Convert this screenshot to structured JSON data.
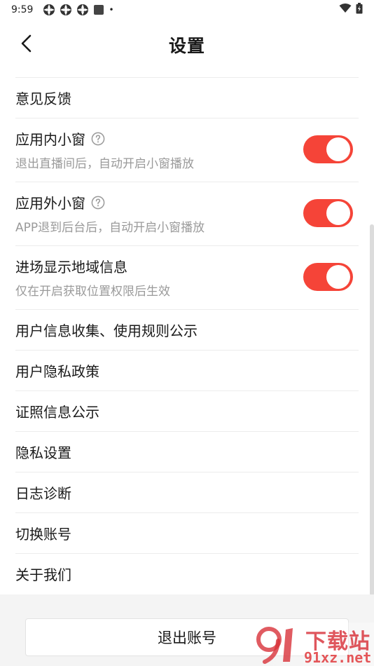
{
  "status_bar": {
    "time": "9:59",
    "notification_icons": [
      "app-icon",
      "app-icon",
      "app-icon",
      "app-icon"
    ],
    "dot": "•"
  },
  "nav": {
    "title": "设置",
    "back_icon": "chevron-left-icon"
  },
  "rows": {
    "feedback": {
      "label": "意见反馈"
    },
    "in_app_window": {
      "label": "应用内小窗",
      "desc": "退出直播间后，自动开启小窗播放",
      "enabled": true
    },
    "out_app_window": {
      "label": "应用外小窗",
      "desc": "APP退到后台后，自动开启小窗播放",
      "enabled": true
    },
    "region_info": {
      "label": "进场显示地域信息",
      "desc": "仅在开启获取位置权限后生效",
      "enabled": true
    },
    "user_info_rules": {
      "label": "用户信息收集、使用规则公示"
    },
    "privacy_policy": {
      "label": "用户隐私政策"
    },
    "license_info": {
      "label": "证照信息公示"
    },
    "privacy_settings": {
      "label": "隐私设置"
    },
    "log_diagnosis": {
      "label": "日志诊断"
    },
    "switch_account": {
      "label": "切换账号"
    },
    "about_us": {
      "label": "关于我们"
    }
  },
  "footer": {
    "logout_label": "退出账号"
  },
  "watermark": {
    "title": "下载站",
    "url": "91xz.net"
  },
  "colors": {
    "accent": "#f54438",
    "divider": "#ececec",
    "subtext": "#9a9a9a",
    "footer_bg": "#f4f4f4"
  }
}
